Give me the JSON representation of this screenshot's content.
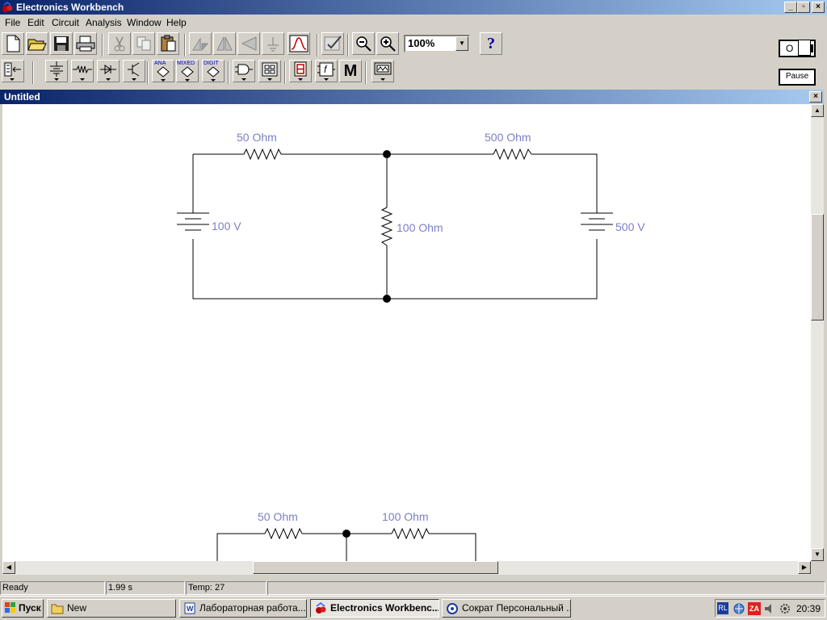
{
  "window": {
    "title": "Electronics Workbench",
    "minimize_glyph": "_",
    "restore_glyph": "▫",
    "close_glyph": "×"
  },
  "menu": [
    "File",
    "Edit",
    "Circuit",
    "Analysis",
    "Window",
    "Help"
  ],
  "toolbar": {
    "zoom_value": "100%",
    "help_glyph": "?",
    "power_label": "O",
    "pause_label": "Pause",
    "parts_labels": {
      "analog": "ANA",
      "mixed": "MIXED",
      "digital": "DIGIT",
      "misc": "M"
    }
  },
  "child_window": {
    "title": "Untitled",
    "close_glyph": "×"
  },
  "circuit1": {
    "r1": "50  Ohm",
    "r2": "500  Ohm",
    "r3": "100  Ohm",
    "v1": "100 V",
    "v2": "500 V"
  },
  "circuit2": {
    "r1": "50  Ohm",
    "r2": "100  Ohm"
  },
  "status": {
    "state": "Ready",
    "time": "1.99 s",
    "temp": "Temp:  27"
  },
  "taskbar": {
    "start_label": "Пуск",
    "tasks": [
      "New",
      "Лабораторная работа....",
      "Electronics Workbenc...",
      "Сократ Персональный ..."
    ],
    "clock": "20:39",
    "lang": "RL",
    "za_label": "ZA"
  },
  "colors": {
    "label_color": "#7b7fc6",
    "title_start": "#0a246a",
    "title_end": "#a6caf0"
  }
}
